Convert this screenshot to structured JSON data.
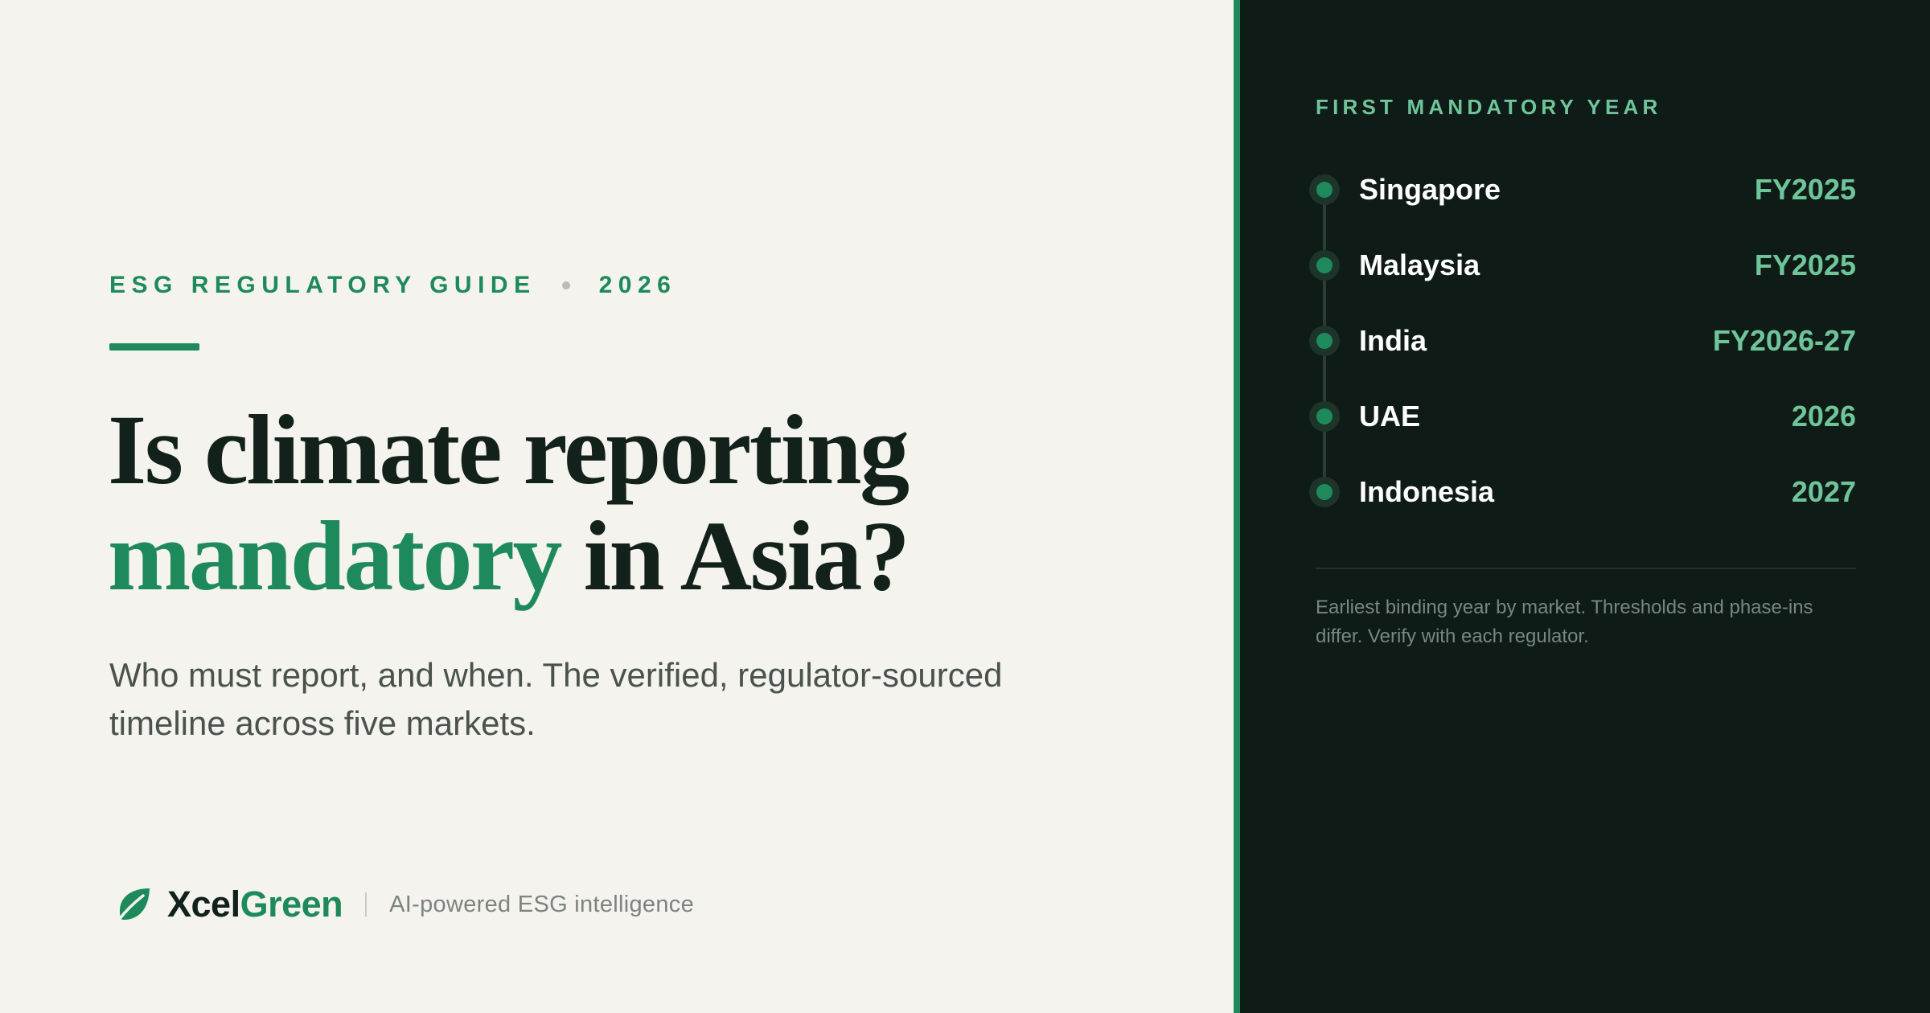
{
  "eyebrow": {
    "guide": "ESG REGULATORY GUIDE",
    "year": "2026"
  },
  "headline": {
    "line1": "Is climate reporting",
    "line2_accent": "mandatory",
    "line2_rest": "in Asia?"
  },
  "subtitle": "Who must report, and when. The verified, regulator-sourced timeline across five markets.",
  "brand": {
    "name_part1": "Xcel",
    "name_part2": "Green",
    "tagline": "AI-powered ESG intelligence",
    "icon": "leaf-icon"
  },
  "panel": {
    "heading": "FIRST MANDATORY YEAR",
    "markets": [
      {
        "country": "Singapore",
        "year": "FY2025"
      },
      {
        "country": "Malaysia",
        "year": "FY2025"
      },
      {
        "country": "India",
        "year": "FY2026-27"
      },
      {
        "country": "UAE",
        "year": "2026"
      },
      {
        "country": "Indonesia",
        "year": "2027"
      }
    ],
    "note": "Earliest binding year by market. Thresholds and phase-ins differ. Verify with each regulator."
  },
  "colors": {
    "accent": "#1e8a5c",
    "accent_light": "#6fc59a",
    "dark_panel": "#0f1b16",
    "background": "#f4f3ee",
    "ink": "#12211a"
  }
}
